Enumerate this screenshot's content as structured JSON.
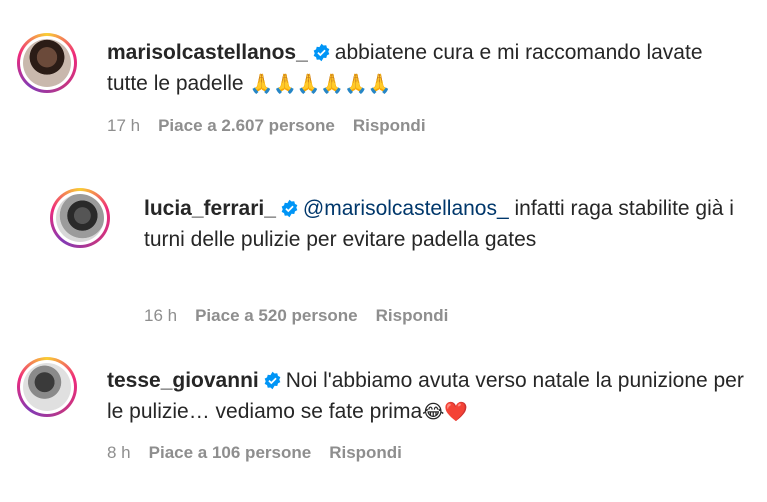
{
  "comments": [
    {
      "username": "marisolcastellanos_",
      "text": "abbiatene cura e mi raccomando lavate tutte le padelle",
      "emoji": "🙏🙏🙏🙏🙏🙏",
      "time": "17 h",
      "likes": "Piace a 2.607 persone",
      "reply": "Rispondi"
    },
    {
      "username": "lucia_ferrari_",
      "mention": "@marisolcastellanos_",
      "text": "infatti raga stabilite già i turni delle pulizie per evitare padella gates",
      "time": "16 h",
      "likes": "Piace a 520 persone",
      "reply": "Rispondi"
    },
    {
      "username": "tesse_giovanni",
      "text": "Noi l'abbiamo avuta verso natale la punizione per le pulizie… vediamo se fate prima",
      "emoji": "😂❤️",
      "time": "8 h",
      "likes": "Piace a 106 persone",
      "reply": "Rispondi"
    }
  ],
  "colors": {
    "text": "#262626",
    "meta": "#8e8e8e",
    "mention": "#00376b",
    "verified": "#0095f6"
  }
}
